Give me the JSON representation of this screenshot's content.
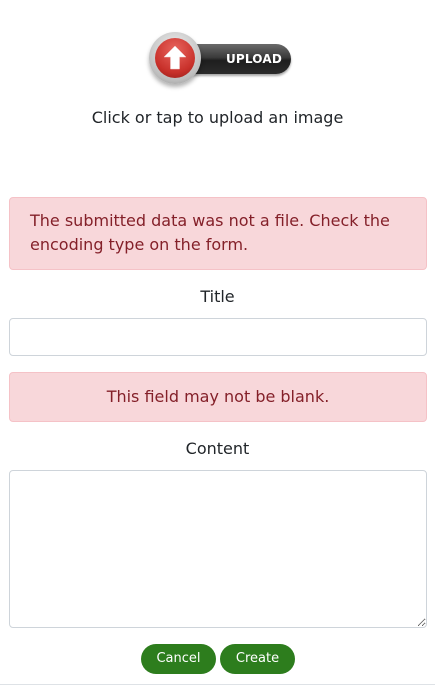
{
  "upload": {
    "button_label": "UPLOAD",
    "hint": "Click or tap to upload an image",
    "icon": "upload-arrow-icon",
    "colors": {
      "circle": "#c8302a",
      "pill": "#2b2b2b"
    }
  },
  "errors": {
    "file": "The submitted data was not a file. Check the encoding type on the form.",
    "title_blank": "This field may not be blank."
  },
  "form": {
    "title_label": "Title",
    "title_value": "",
    "content_label": "Content",
    "content_value": ""
  },
  "actions": {
    "cancel_label": "Cancel",
    "create_label": "Create"
  },
  "colors": {
    "alert_background": "#f8d7da",
    "alert_text": "#842029",
    "button": "#2d7d1d"
  }
}
